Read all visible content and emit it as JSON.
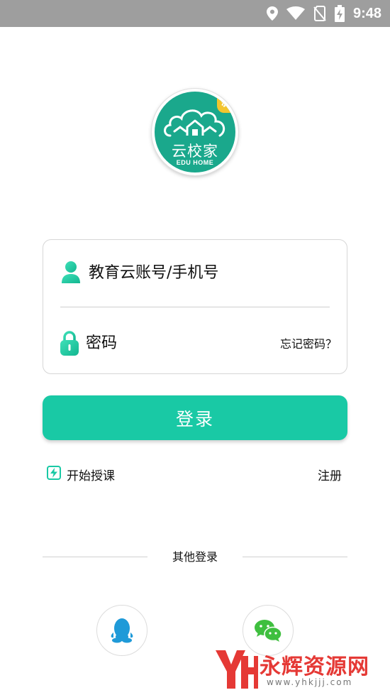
{
  "status_bar": {
    "time": "9:48",
    "icons": [
      "location-icon",
      "wifi-icon",
      "no-sim-icon",
      "battery-charging-icon"
    ]
  },
  "logo": {
    "name_cn": "云校家",
    "name_en": "EDU HOME",
    "badge": "新",
    "colors": {
      "primary": "#1aa88c",
      "badge": "#f3c52e"
    }
  },
  "form": {
    "account_placeholder": "教育云账号/手机号",
    "account_value": "",
    "password_placeholder": "密码",
    "password_value": "",
    "forgot_password": "忘记密码？",
    "account_icon": "user-icon",
    "password_icon": "lock-icon"
  },
  "login": {
    "label": "登录",
    "color": "#19c9a5"
  },
  "links": {
    "teach": "开始授课",
    "teach_icon": "lightning-icon",
    "register": "注册"
  },
  "other_login": {
    "label": "其他登录",
    "providers": [
      {
        "name": "qq",
        "icon": "qq-penguin-icon"
      },
      {
        "name": "wechat",
        "icon": "wechat-icon"
      }
    ]
  },
  "watermark": {
    "text": "永辉资源网",
    "url": "www.yhkjjj.com"
  }
}
